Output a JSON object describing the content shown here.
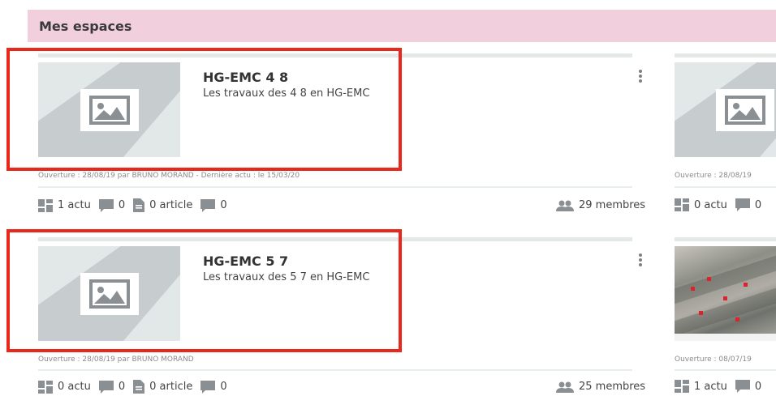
{
  "section": {
    "title": "Mes espaces"
  },
  "cards": [
    {
      "title": "HG-EMC 4 8",
      "description": "Les travaux des 4 8 en HG-EMC",
      "meta": "Ouverture : 28/08/19 par BRUNO MORAND - Dernière actu : le 15/03/20",
      "stats": {
        "actu": "1 actu",
        "comments": "0",
        "article": "0 article",
        "messages": "0"
      },
      "members": "29 membres"
    },
    {
      "title": "HG-EMC 5 7",
      "description": "Les travaux des 5 7 en HG-EMC",
      "meta": "Ouverture : 28/08/19 par BRUNO MORAND",
      "stats": {
        "actu": "0 actu",
        "comments": "0",
        "article": "0 article",
        "messages": "0"
      },
      "members": "25 membres"
    }
  ],
  "partial_cards": [
    {
      "meta": "Ouverture : 28/08/19",
      "stats": {
        "actu": "0 actu",
        "comments": "0"
      }
    },
    {
      "meta": "Ouverture : 08/07/19",
      "stats": {
        "actu": "1 actu",
        "comments": "0"
      }
    }
  ],
  "icons": {
    "image_placeholder": "image-icon",
    "actu": "dashboard-icon",
    "comment": "comment-icon",
    "article": "document-icon",
    "members": "people-icon",
    "menu": "kebab-menu-icon"
  },
  "colors": {
    "header_bg": "#f2cfdc",
    "highlight": "#e8281a",
    "icon_gray": "#8a8f93"
  }
}
